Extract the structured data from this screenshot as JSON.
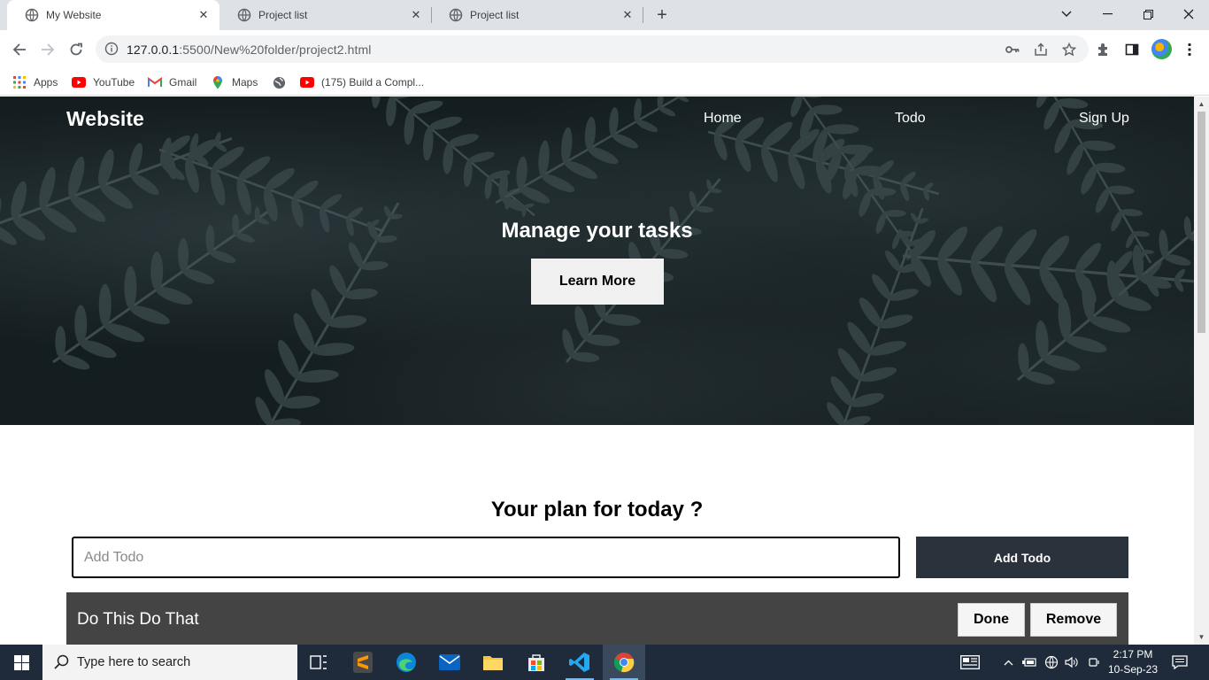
{
  "browser": {
    "tabs": [
      {
        "label": "My Website",
        "active": true
      },
      {
        "label": "Project list",
        "active": false
      },
      {
        "label": "Project list",
        "active": false
      }
    ],
    "url_host": "127.0.0.1",
    "url_rest": ":5500/New%20folder/project2.html",
    "bookmarks": [
      {
        "label": "Apps",
        "icon": "apps-grid-icon"
      },
      {
        "label": "YouTube",
        "icon": "youtube-icon"
      },
      {
        "label": "Gmail",
        "icon": "gmail-icon"
      },
      {
        "label": "Maps",
        "icon": "maps-icon"
      },
      {
        "label": "",
        "icon": "globe-icon"
      },
      {
        "label": "(175) Build a Compl...",
        "icon": "youtube-icon"
      }
    ]
  },
  "site": {
    "logo": "Website",
    "nav": [
      "Home",
      "Todo",
      "Sign Up"
    ],
    "hero_title": "Manage your tasks",
    "hero_button": "Learn More",
    "plan_title": "Your plan for today ?",
    "input_placeholder": "Add Todo",
    "input_value": "",
    "add_button": "Add Todo",
    "todos": [
      {
        "text": "Do This Do That",
        "done_label": "Done",
        "remove_label": "Remove"
      }
    ]
  },
  "taskbar": {
    "search_placeholder": "Type here to search",
    "time": "2:17 PM",
    "date": "10-Sep-23"
  },
  "colors": {
    "hero_bg": "#141d20",
    "add_button_bg": "#2a333b",
    "todo_item_bg": "#444444",
    "taskbar_bg": "#1f2b3a"
  }
}
